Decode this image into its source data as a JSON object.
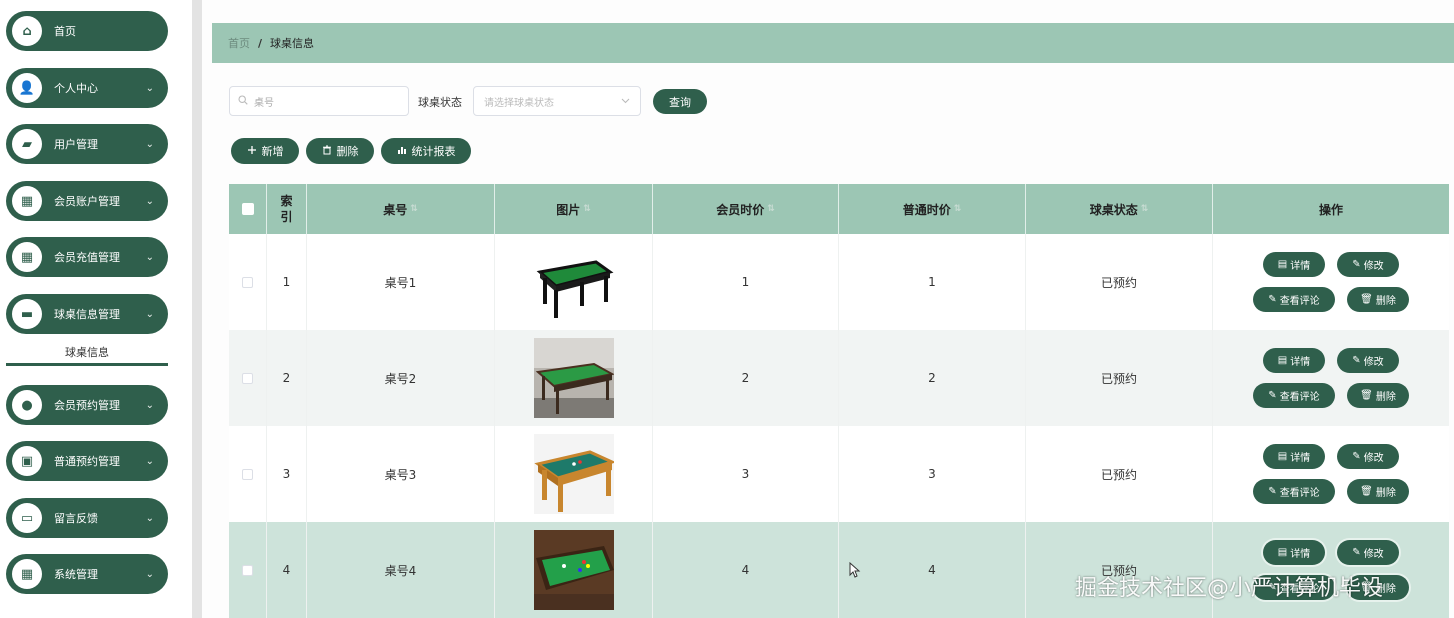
{
  "sidebar": {
    "items": [
      {
        "label": "首页",
        "icon": "home-icon",
        "glyph": "⌂",
        "chevron": ""
      },
      {
        "label": "个人中心",
        "icon": "user-icon",
        "glyph": "👤",
        "chevron": "⌄"
      },
      {
        "label": "用户管理",
        "icon": "users-icon",
        "glyph": "▰",
        "chevron": "⌄"
      },
      {
        "label": "会员账户管理",
        "icon": "grid-icon",
        "glyph": "▦",
        "chevron": "⌄"
      },
      {
        "label": "会员充值管理",
        "icon": "grid-icon",
        "glyph": "▦",
        "chevron": "⌄"
      },
      {
        "label": "球桌信息管理",
        "icon": "message-icon",
        "glyph": "▬",
        "chevron": "⌄"
      },
      {
        "label": "会员预约管理",
        "icon": "location-icon",
        "glyph": "●",
        "chevron": "⌄"
      },
      {
        "label": "普通预约管理",
        "icon": "clipboard-icon",
        "glyph": "▣",
        "chevron": "⌄"
      },
      {
        "label": "留言反馈",
        "icon": "monitor-icon",
        "glyph": "▭",
        "chevron": "⌄"
      },
      {
        "label": "系统管理",
        "icon": "grid-icon",
        "glyph": "▦",
        "chevron": "⌄"
      }
    ],
    "sub_item": "球桌信息"
  },
  "breadcrumb": {
    "home": "首页",
    "separator": "/",
    "current": "球桌信息"
  },
  "search": {
    "placeholder": "桌号",
    "status_label": "球桌状态",
    "status_placeholder": "请选择球桌状态",
    "query_label": "查询"
  },
  "actions": {
    "add": "新增",
    "delete": "删除",
    "report": "统计报表"
  },
  "table": {
    "headers": [
      "索引",
      "桌号",
      "图片",
      "会员时价",
      "普通时价",
      "球桌状态",
      "操作"
    ],
    "rows": [
      {
        "index": "1",
        "table_no": "桌号1",
        "member_price": "1",
        "normal_price": "1",
        "status": "已预约"
      },
      {
        "index": "2",
        "table_no": "桌号2",
        "member_price": "2",
        "normal_price": "2",
        "status": "已预约"
      },
      {
        "index": "3",
        "table_no": "桌号3",
        "member_price": "3",
        "normal_price": "3",
        "status": "已预约"
      },
      {
        "index": "4",
        "table_no": "桌号4",
        "member_price": "4",
        "normal_price": "4",
        "status": "已预约"
      }
    ],
    "ops": {
      "detail": "详情",
      "edit": "修改",
      "comments": "查看评论",
      "delete": "删除"
    }
  },
  "colors": {
    "primary": "#2f5f4c",
    "header": "#9cc6b4",
    "highlight_row": "#cde3da"
  },
  "watermark": "掘金技术社区@小严计算机毕设"
}
